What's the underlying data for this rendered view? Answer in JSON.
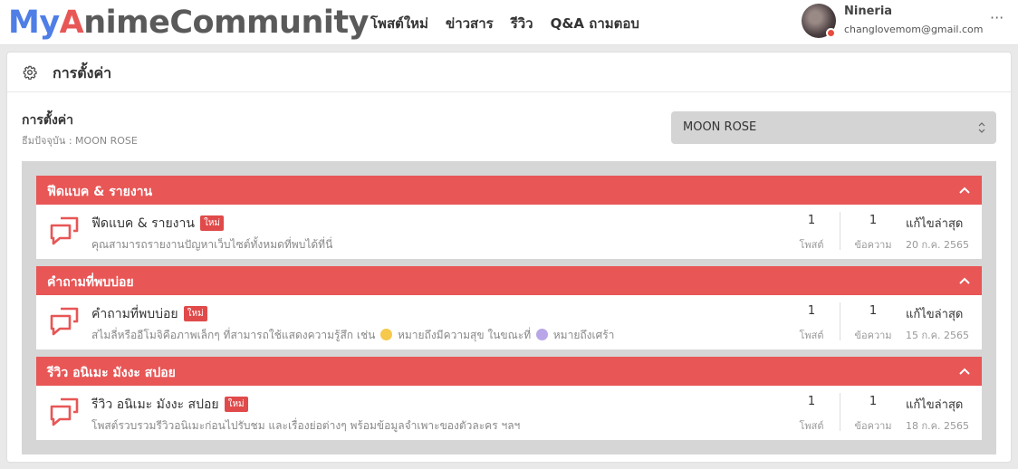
{
  "header": {
    "logo_part1": "My",
    "logo_part2": "A",
    "logo_part3": "nimeCommunity",
    "nav": [
      "โพสต์ใหม่",
      "ข่าวสาร",
      "รีวิว",
      "Q&A ถามตอบ"
    ],
    "user_name": "Nineria",
    "user_email": "changlovemom@gmail.com",
    "more": "···"
  },
  "page": {
    "title": "การตั้งค่า",
    "settings_label": "การตั้งค่า",
    "theme_current": "ธีมปัจจุบัน : MOON ROSE",
    "theme_select_value": "MOON ROSE"
  },
  "sections": [
    {
      "title": "ฟีดแบค & รายงาน",
      "forum_title": "ฟีดแบค & รายงาน",
      "badge": "ใหม่",
      "desc": "คุณสามารถรายงานปัญหาเว็บไซต์ทั้งหมดที่พบได้ที่นี่",
      "posts": "1",
      "posts_label": "โพสต์",
      "messages": "1",
      "messages_label": "ข้อความ",
      "latest_label": "แก้ไขล่าสุด",
      "latest_date": "20 ก.ค. 2565"
    },
    {
      "title": "คำถามที่พบบ่อย",
      "forum_title": "คำถามที่พบบ่อย",
      "badge": "ใหม่",
      "desc_a": "สไมลี่หรืออีโมจิคือภาพเล็กๆ ที่สามารถใช้แสดงความรู้สึก เช่น",
      "desc_b": "หมายถึงมีความสุข ในขณะที่",
      "desc_c": "หมายถึงเศร้า",
      "posts": "1",
      "posts_label": "โพสต์",
      "messages": "1",
      "messages_label": "ข้อความ",
      "latest_label": "แก้ไขล่าสุด",
      "latest_date": "15 ก.ค. 2565"
    },
    {
      "title": "รีวิว อนิเมะ มังงะ สปอย",
      "forum_title": "รีวิว อนิเมะ มังงะ สปอย",
      "badge": "ใหม่",
      "desc": "โพสต์รวบรวมรีวิวอนิเมะก่อนไปรับชม และเรื่องย่อต่างๆ พร้อมข้อมูลจำเพาะของตัวละคร ฯลฯ",
      "posts": "1",
      "posts_label": "โพสต์",
      "messages": "1",
      "messages_label": "ข้อความ",
      "latest_label": "แก้ไขล่าสุด",
      "latest_date": "18 ก.ค. 2565"
    }
  ],
  "colors": {
    "accent": "#e85656",
    "brand_blue": "#4f7ee6"
  },
  "icons": [
    "gear-icon",
    "chat-bubble-icon",
    "chevron-up-icon",
    "select-arrows-icon"
  ]
}
